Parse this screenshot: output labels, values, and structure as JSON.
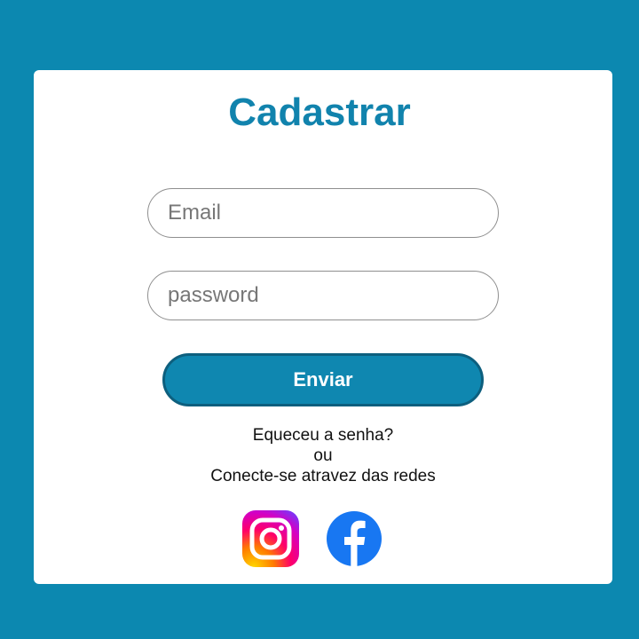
{
  "form": {
    "title": "Cadastrar",
    "email_placeholder": "Email",
    "password_placeholder": "password",
    "submit_label": "Enviar"
  },
  "links": {
    "forgot_password": "Equeceu a senha?",
    "or": "ou",
    "social_connect": "Conecte-se atravez das redes"
  },
  "social": {
    "instagram_icon": "instagram-icon",
    "facebook_icon": "facebook-icon"
  },
  "colors": {
    "background": "#0c88b0",
    "card": "#ffffff",
    "accent": "#1183ad",
    "button_border": "#0d5f7e",
    "facebook": "#1877f2"
  }
}
